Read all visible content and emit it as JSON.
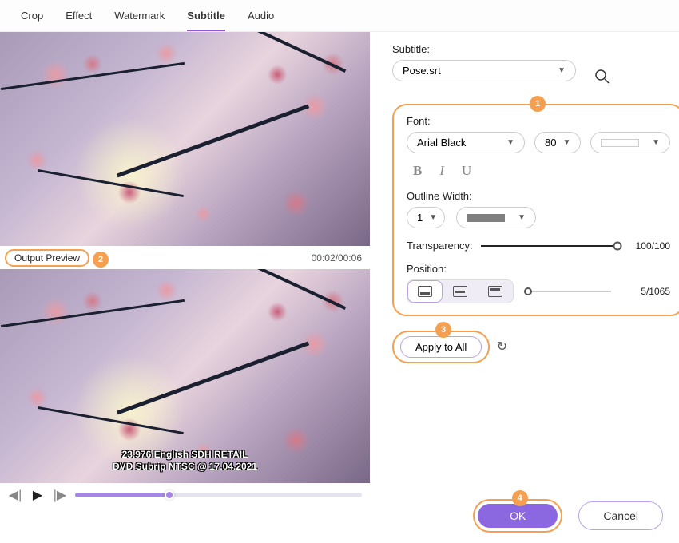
{
  "tabs": [
    "Crop",
    "Effect",
    "Watermark",
    "Subtitle",
    "Audio"
  ],
  "activeTab": "Subtitle",
  "preview": {
    "outputPreviewLabel": "Output Preview",
    "timeLabel": "00:02/00:06",
    "subtitleLine1": "23.976 English SDH RETAIL",
    "subtitleLine2": "DVD Subrip NTSC @ 17.04.2021"
  },
  "subtitle": {
    "label": "Subtitle:",
    "file": "Pose.srt"
  },
  "font": {
    "label": "Font:",
    "name": "Arial Black",
    "size": "80"
  },
  "outline": {
    "label": "Outline Width:",
    "width": "1"
  },
  "transparency": {
    "label": "Transparency:",
    "value": "100/100"
  },
  "position": {
    "label": "Position:",
    "value": "5/1065"
  },
  "applyToAll": "Apply to All",
  "okLabel": "OK",
  "cancelLabel": "Cancel",
  "callouts": {
    "c1": "1",
    "c2": "2",
    "c3": "3",
    "c4": "4"
  }
}
